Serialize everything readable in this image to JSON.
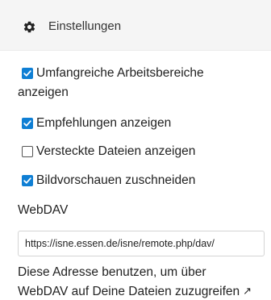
{
  "header": {
    "icon": "gear-icon",
    "title": "Einstellungen"
  },
  "settings": {
    "workspaces": {
      "label_line1": "Umfangreiche Arbeitsbereiche",
      "label_line2": "anzeigen",
      "checked": true
    },
    "recommendations": {
      "label": "Empfehlungen anzeigen",
      "checked": true
    },
    "hidden_files": {
      "label": "Versteckte Dateien anzeigen",
      "checked": false
    },
    "crop_previews": {
      "label": "Bildvorschauen zuschneiden",
      "checked": true
    }
  },
  "webdav": {
    "title": "WebDAV",
    "url": "https://isne.essen.de/isne/remote.php/dav/",
    "description_line1": "Diese Adresse benutzen, um über",
    "description_line2": "WebDAV auf Deine Dateien zuzugreifen",
    "link_icon": "external-link-icon"
  },
  "colors": {
    "accent": "#0f7fd4",
    "header_bg": "#f5f5f5"
  }
}
